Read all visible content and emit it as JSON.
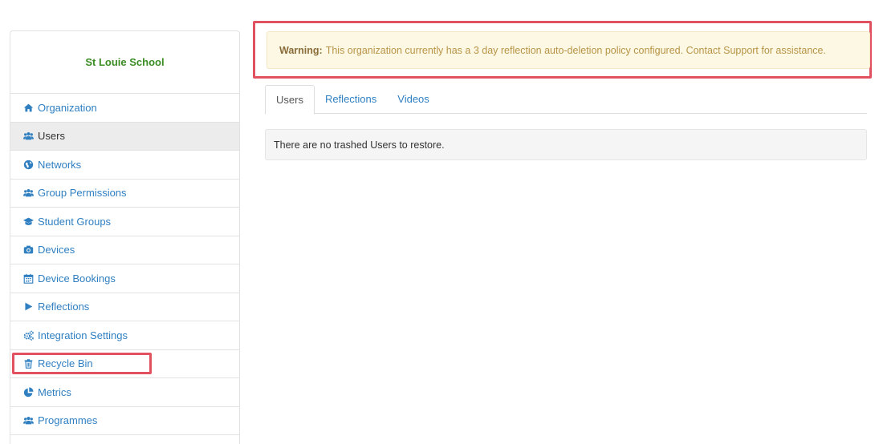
{
  "organization": {
    "name": "St Louie School"
  },
  "sidebar": {
    "items": [
      {
        "label": "Organization",
        "icon": "home-icon"
      },
      {
        "label": "Users",
        "icon": "users-icon",
        "active": true
      },
      {
        "label": "Networks",
        "icon": "globe-icon"
      },
      {
        "label": "Group Permissions",
        "icon": "users-icon"
      },
      {
        "label": "Student Groups",
        "icon": "graduation-cap-icon"
      },
      {
        "label": "Devices",
        "icon": "camera-icon"
      },
      {
        "label": "Device Bookings",
        "icon": "calendar-icon"
      },
      {
        "label": "Reflections",
        "icon": "play-icon"
      },
      {
        "label": "Integration Settings",
        "icon": "cogs-icon"
      },
      {
        "label": "Recycle Bin",
        "icon": "trash-icon"
      },
      {
        "label": "Metrics",
        "icon": "pie-chart-icon"
      },
      {
        "label": "Programmes",
        "icon": "users-icon"
      }
    ]
  },
  "warning": {
    "label": "Warning:",
    "message": "This organization currently has a 3 day reflection auto-deletion policy configured. Contact Support for assistance."
  },
  "tabs": [
    {
      "label": "Users",
      "active": true
    },
    {
      "label": "Reflections"
    },
    {
      "label": "Videos"
    }
  ],
  "panel": {
    "message": "There are no trashed Users to restore."
  },
  "colors": {
    "link": "#2f7fc1",
    "brand_green": "#3a8c22",
    "highlight": "#e25160",
    "warning_bg": "#fcf8e3"
  }
}
